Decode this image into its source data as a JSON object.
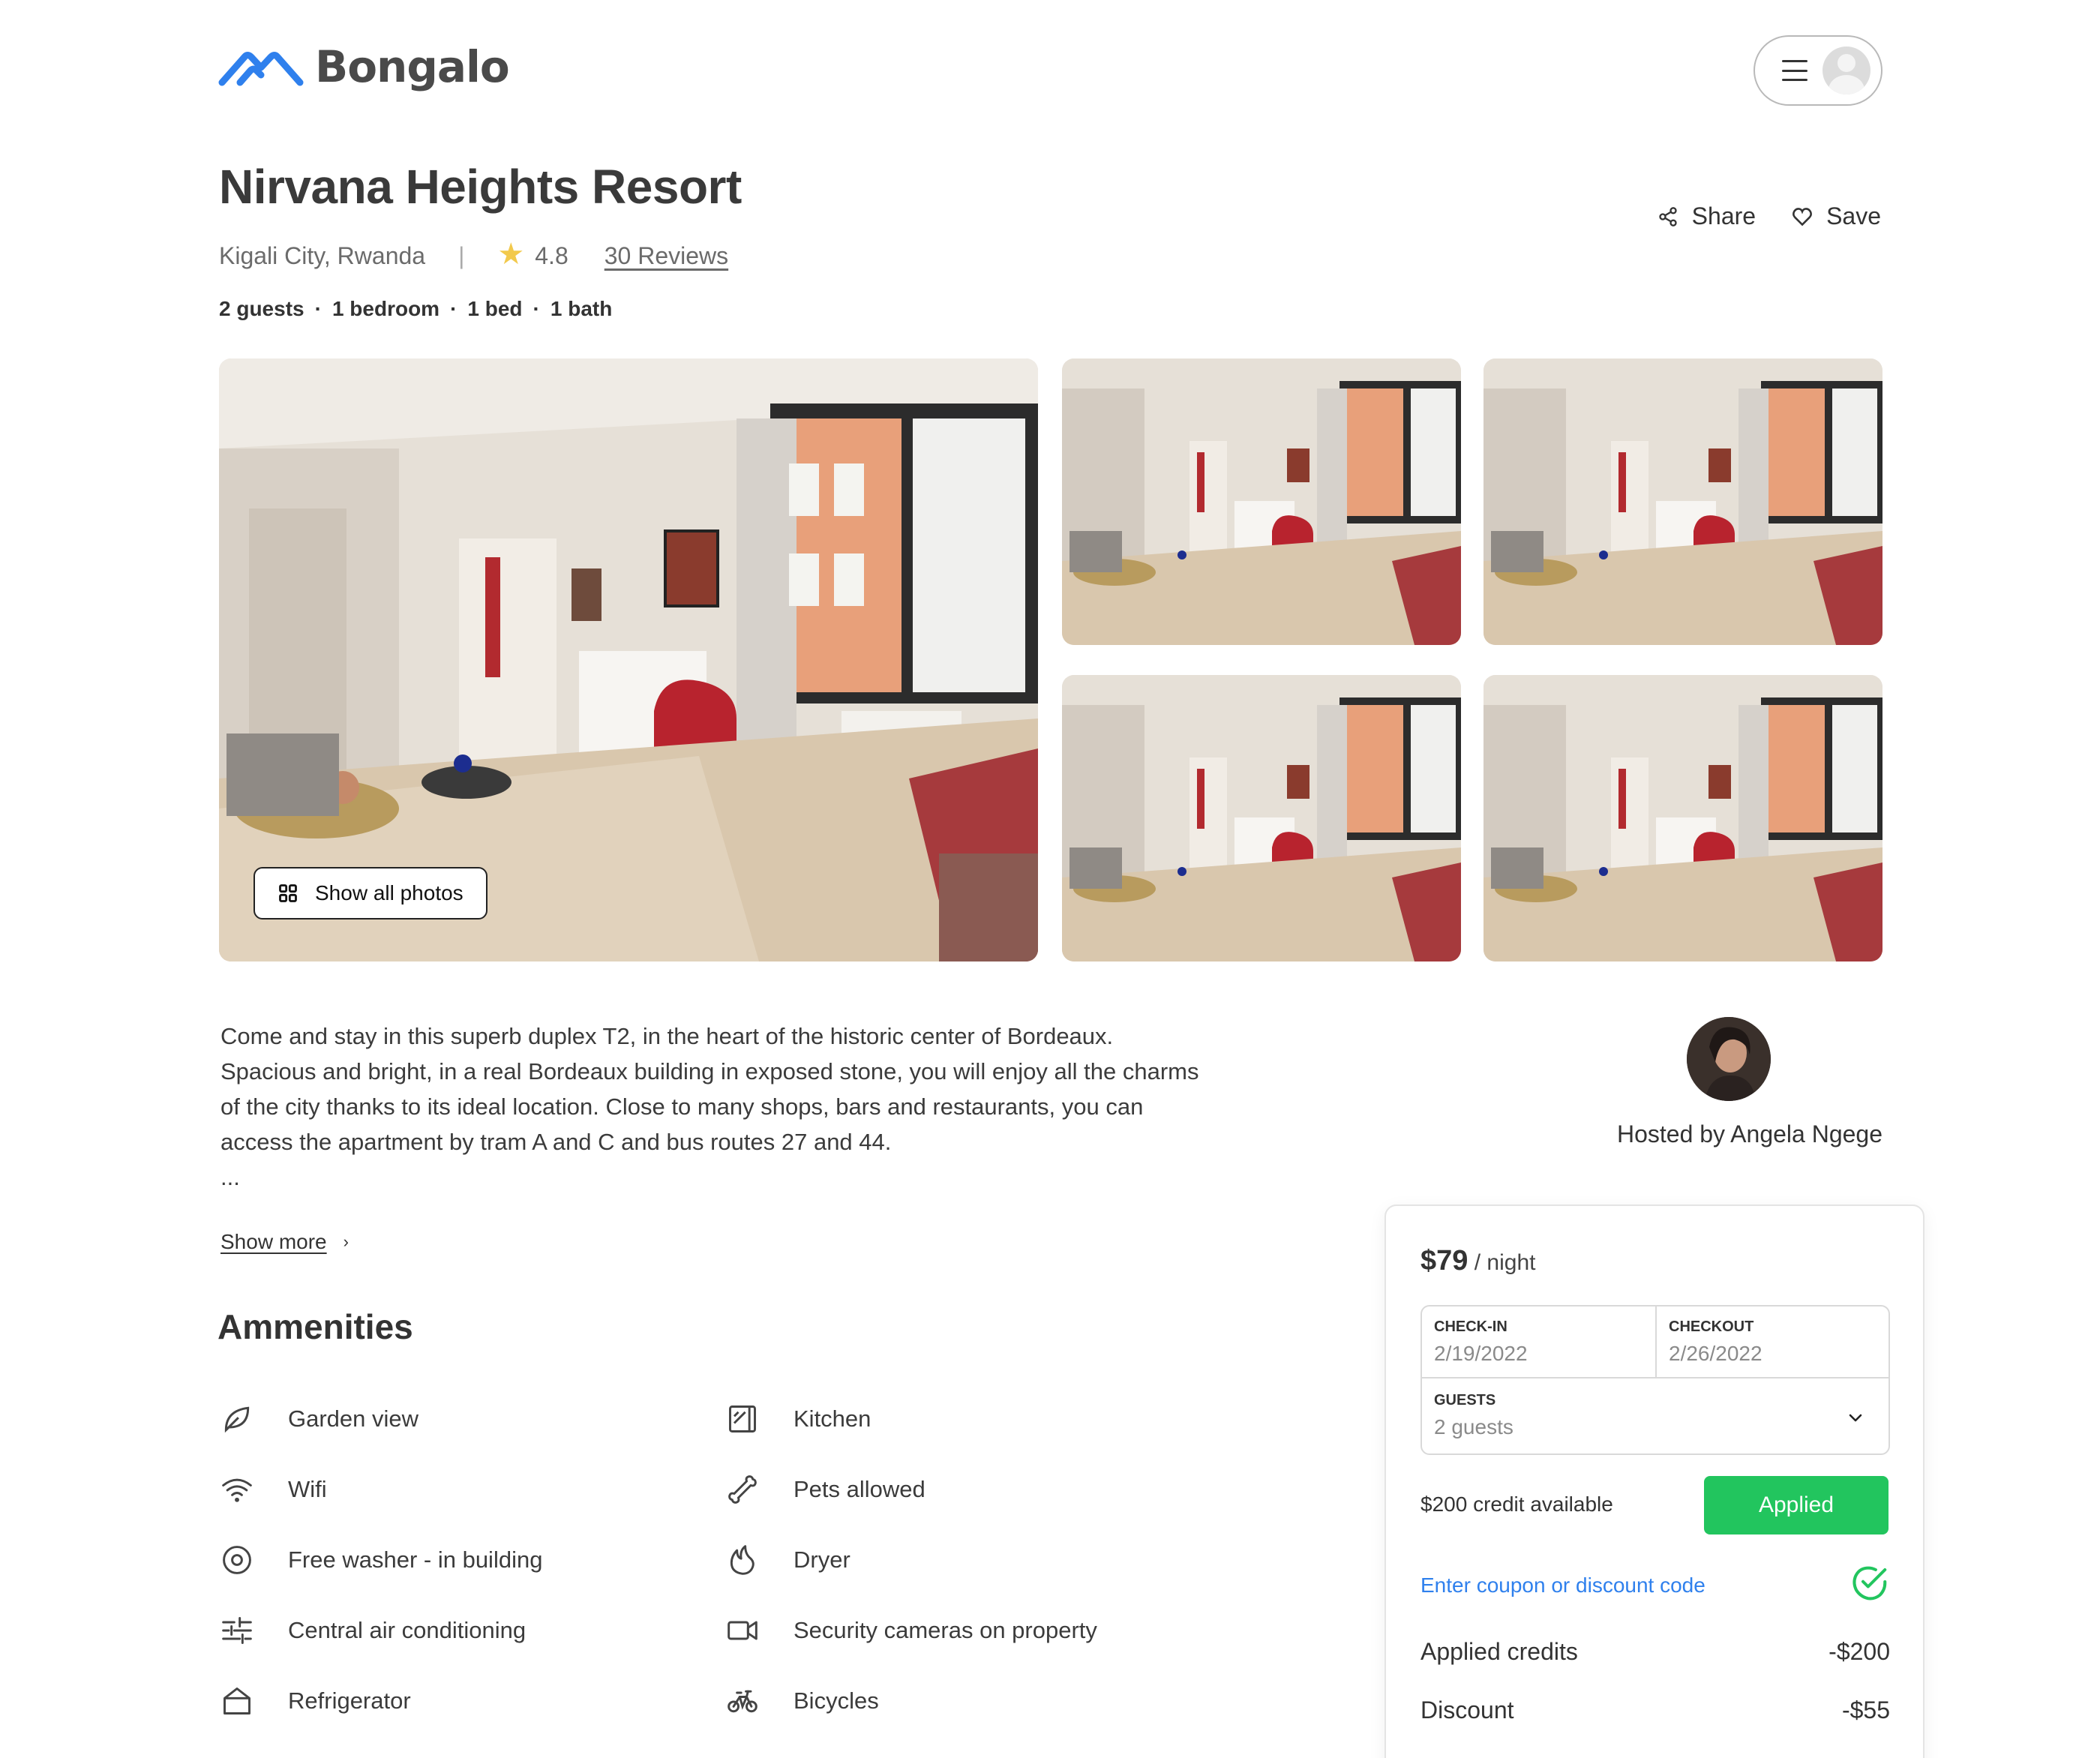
{
  "brand": {
    "name": "Bongalo",
    "accent": "#2f80ed"
  },
  "header": {
    "menu_icon": "hamburger-icon",
    "avatar_icon": "user-avatar-icon"
  },
  "listing": {
    "title": "Nirvana Heights Resort",
    "location": "Kigali City, Rwanda",
    "separator": "|",
    "rating": "4.8",
    "reviews": "30 Reviews",
    "specs": [
      "2 guests",
      "1 bedroom",
      "1 bed",
      "1 bath"
    ],
    "spec_dot": "·",
    "share_label": "Share",
    "save_label": "Save"
  },
  "gallery": {
    "show_all_label": "Show all photos",
    "photo_count": 5
  },
  "description": {
    "text": "Come and stay in this superb duplex T2, in the heart of the historic center of Bordeaux. Spacious and bright, in a real Bordeaux building in exposed stone, you will enjoy all the charms of the city thanks to its ideal location. Close to many shops, bars and restaurants, you can access the apartment by tram A and C and bus routes 27 and 44.",
    "ellipsis": "...",
    "show_more": "Show more",
    "show_more_chevron": "›"
  },
  "host": {
    "name": "Hosted by Angela Ngege"
  },
  "amenities": {
    "title": "Ammenities",
    "items": [
      {
        "label": "Garden view",
        "icon": "leaf-icon"
      },
      {
        "label": "Kitchen",
        "icon": "kitchen-icon"
      },
      {
        "label": "Wifi",
        "icon": "wifi-icon"
      },
      {
        "label": "Pets allowed",
        "icon": "bone-icon"
      },
      {
        "label": "Free washer - in building",
        "icon": "washer-icon"
      },
      {
        "label": "Dryer",
        "icon": "flame-icon"
      },
      {
        "label": "Central air conditioning",
        "icon": "air-conditioning-icon"
      },
      {
        "label": "Security cameras on property",
        "icon": "camera-icon"
      },
      {
        "label": "Refrigerator",
        "icon": "refrigerator-icon"
      },
      {
        "label": "Bicycles",
        "icon": "bicycle-icon"
      }
    ]
  },
  "booking": {
    "price": "$79",
    "per_night": " / night",
    "checkin_label": "CHECK-IN",
    "checkin_value": "2/19/2022",
    "checkout_label": "CHECKOUT",
    "checkout_value": "2/26/2022",
    "guests_label": "GUESTS",
    "guests_value": "2 guests",
    "credit_text": "$200 credit available",
    "applied_label": "Applied",
    "coupon_label": "Enter coupon or discount code",
    "applied_credits_label": "Applied credits",
    "applied_credits_value": "-$200",
    "discount_label": "Discount",
    "discount_value": "-$55",
    "success_color": "#22c55e"
  }
}
